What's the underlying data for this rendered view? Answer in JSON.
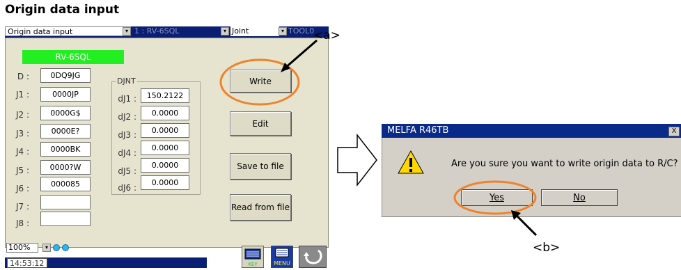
{
  "caption": "Origin data input",
  "topbar": {
    "mode": "Origin data input",
    "robot": "1 : RV-6SQL",
    "joint": "Joint",
    "tool": "TOOL0"
  },
  "panel": {
    "robot_name": "RV-6SQL",
    "d_label": "D :",
    "d_value": "0DQ9JG",
    "j_rows": [
      {
        "label": "J1 :",
        "value": "0000JP"
      },
      {
        "label": "J2 :",
        "value": "0000G$"
      },
      {
        "label": "J3 :",
        "value": "0000E?"
      },
      {
        "label": "J4 :",
        "value": "0000BK"
      },
      {
        "label": "J5 :",
        "value": "0000?W"
      },
      {
        "label": "J6 :",
        "value": "000085"
      },
      {
        "label": "J7 :",
        "value": ""
      },
      {
        "label": "J8 :",
        "value": ""
      }
    ],
    "djnt_title": "DJNT",
    "djnt_rows": [
      {
        "label": "dJ1 :",
        "value": "150.2122"
      },
      {
        "label": "dJ2 :",
        "value": "0.0000"
      },
      {
        "label": "dJ3 :",
        "value": "0.0000"
      },
      {
        "label": "dJ4 :",
        "value": "0.0000"
      },
      {
        "label": "dJ5 :",
        "value": "0.0000"
      },
      {
        "label": "dJ6 :",
        "value": "0.0000"
      }
    ],
    "buttons": {
      "write": "Write",
      "edit": "Edit",
      "save": "Save to file",
      "read": "Read from file"
    },
    "zoom": "100%",
    "time": "14:53:12",
    "key_icon_label": "KEY",
    "menu_icon_label": "MENU"
  },
  "dialog": {
    "title": "MELFA R46TB",
    "close": "X",
    "message": "Are you sure you want to write origin data to R/C?",
    "yes": "Yes",
    "no": "No"
  },
  "annotations": {
    "a": "<a>",
    "b": "<b>"
  },
  "colors": {
    "accent_orange": "#f0822a",
    "title_blue": "#0a1f73",
    "robot_green": "#22ee22"
  }
}
